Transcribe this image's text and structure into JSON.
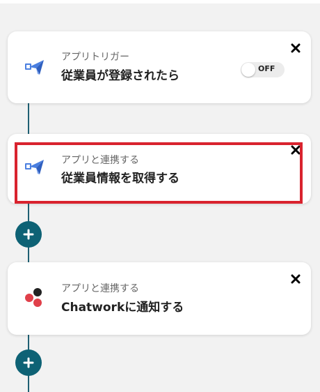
{
  "flow": {
    "steps": [
      {
        "subtitle": "アプリトリガー",
        "title": "従業員が登録されたら",
        "icon": "paper-plane-app-icon",
        "toggle": {
          "label": "OFF",
          "on": false
        }
      },
      {
        "subtitle": "アプリと連携する",
        "title": "従業員情報を取得する",
        "icon": "paper-plane-app-icon",
        "highlighted": true
      },
      {
        "subtitle": "アプリと連携する",
        "title": "Chatworkに通知する",
        "icon": "chatwork-icon"
      }
    ]
  },
  "colors": {
    "background": "#f2f2f2",
    "connector": "#1f5f73",
    "add_button": "#0e6275",
    "highlight": "#d9232e",
    "chatwork_red": "#e0404a",
    "chatwork_dark": "#222222",
    "plane_blue": "#4a7fe0"
  }
}
